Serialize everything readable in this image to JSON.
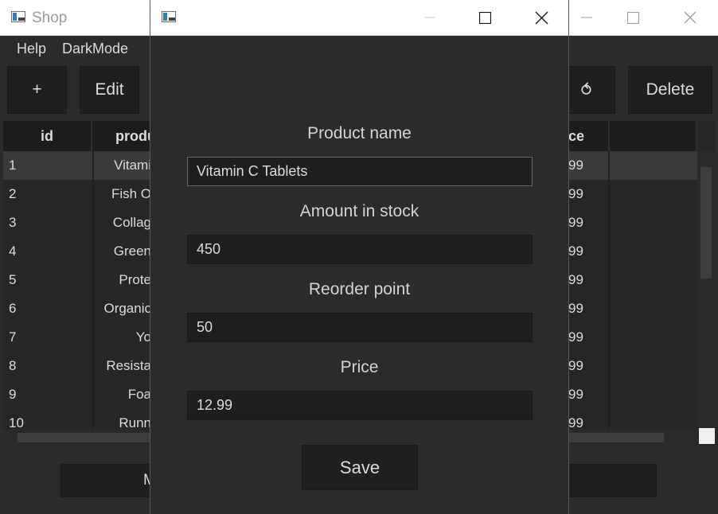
{
  "main_window": {
    "title": "Shop",
    "menu": [
      "Help",
      "DarkMode"
    ],
    "toolbar": {
      "add_label": "+",
      "edit_label": "Edit",
      "refresh_glyph": "⥀",
      "delete_label": "Delete"
    },
    "table": {
      "columns": [
        "id",
        "produ",
        "ce"
      ],
      "rows": [
        {
          "id": "1",
          "product": "Vitami",
          "price": "99"
        },
        {
          "id": "2",
          "product": "Fish O",
          "price": "99"
        },
        {
          "id": "3",
          "product": "Collag",
          "price": "99"
        },
        {
          "id": "4",
          "product": "Green",
          "price": "99"
        },
        {
          "id": "5",
          "product": "Prote",
          "price": "99"
        },
        {
          "id": "6",
          "product": "Organic",
          "price": "99"
        },
        {
          "id": "7",
          "product": "Yo",
          "price": "99"
        },
        {
          "id": "8",
          "product": "Resista",
          "price": "99"
        },
        {
          "id": "9",
          "product": "Foa",
          "price": "99"
        },
        {
          "id": "10",
          "product": "Runn",
          "price": "99"
        }
      ],
      "selected_row": 1
    },
    "bottom_button_left_label": "M"
  },
  "dialog": {
    "title": "",
    "fields": {
      "product_name": {
        "label": "Product name",
        "value": "Vitamin C Tablets"
      },
      "amount_in_stock": {
        "label": "Amount in stock",
        "value": "450"
      },
      "reorder_point": {
        "label": "Reorder point",
        "value": "50"
      },
      "price": {
        "label": "Price",
        "value": "12.99"
      }
    },
    "save_label": "Save"
  },
  "icons": {
    "minimize": "minimize-icon",
    "maximize": "maximize-icon",
    "close": "close-icon",
    "app": "app-icon"
  },
  "colors": {
    "background": "#2b2b2b",
    "input_bg": "#1e1e1e",
    "selection_bg": "#3a3a3a",
    "titlebar": "#ffffff"
  }
}
